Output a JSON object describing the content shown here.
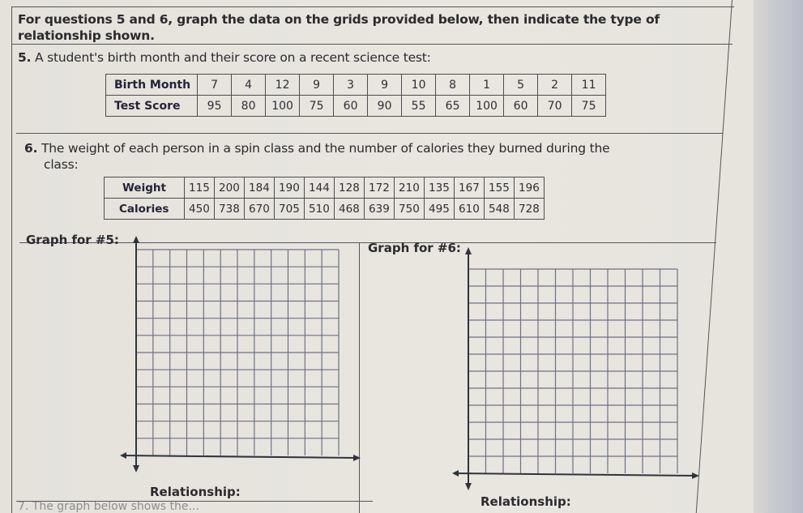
{
  "worksheet": {
    "intro": "For questions 5 and 6, graph the data on the grids provided below, then indicate the type of relationship shown.",
    "question5": {
      "number": "5.",
      "prompt": "A student's birth month and their score on a recent science test:",
      "table": {
        "row_headers": [
          "Birth Month",
          "Test Score"
        ],
        "birth_month": [
          "7",
          "4",
          "12",
          "9",
          "3",
          "9",
          "10",
          "8",
          "1",
          "5",
          "2",
          "11"
        ],
        "test_score": [
          "95",
          "80",
          "100",
          "75",
          "60",
          "90",
          "55",
          "65",
          "100",
          "60",
          "70",
          "75"
        ]
      }
    },
    "question6": {
      "number": "6.",
      "prompt_line1": "The weight of each person in a spin class and the number of calories they burned during the",
      "prompt_line2": "class:",
      "table": {
        "row_headers": [
          "Weight",
          "Calories"
        ],
        "weight": [
          "115",
          "200",
          "184",
          "190",
          "144",
          "128",
          "172",
          "210",
          "135",
          "167",
          "155",
          "196"
        ],
        "calories": [
          "450",
          "738",
          "670",
          "705",
          "510",
          "468",
          "639",
          "750",
          "495",
          "610",
          "548",
          "728"
        ]
      }
    },
    "graph5": {
      "label": "Graph for #5:",
      "relationship_label": "Relationship:",
      "grid_columns": 12,
      "grid_rows": 12
    },
    "graph6": {
      "label": "Graph for #6:",
      "relationship_label": "Relationship:",
      "grid_columns": 12,
      "grid_rows": 12
    },
    "question7_partial": "7.  The graph below shows the..."
  },
  "colors": {
    "paper": "#e6e4dd",
    "grid_line": "#6f6f8c",
    "axis": "#2f3340",
    "border": "#55555a"
  }
}
